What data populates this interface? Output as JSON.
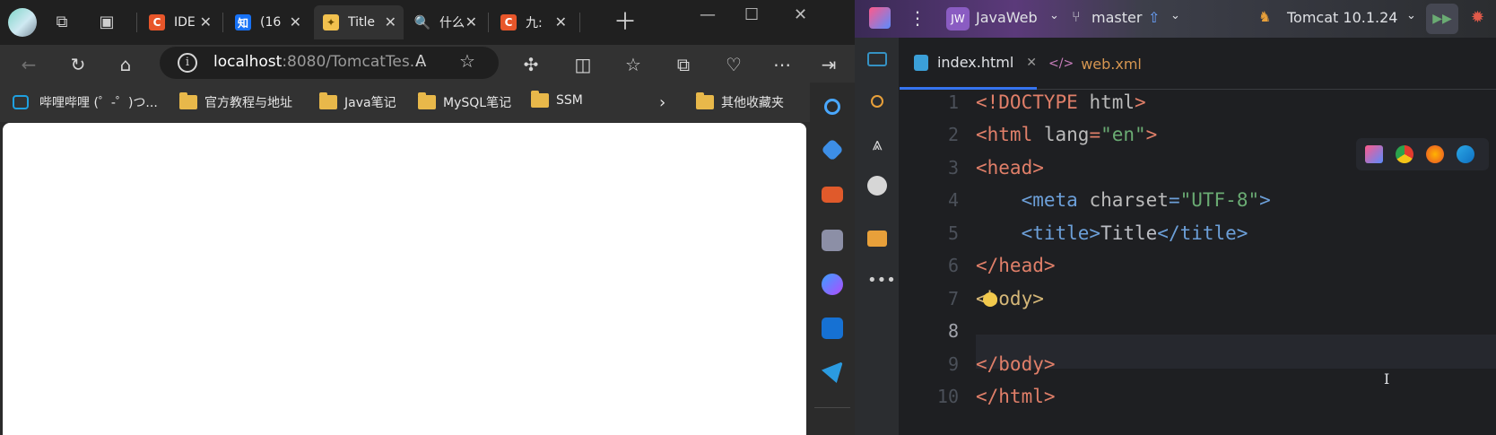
{
  "browser": {
    "tabs": [
      {
        "label": "IDE",
        "favicon": "C",
        "color": "#e8562a"
      },
      {
        "label": "(16",
        "favicon": "知",
        "color": "#1772f6"
      },
      {
        "label": "Title",
        "favicon": "tomcat",
        "color": "#f2c14e"
      },
      {
        "label": "什么",
        "favicon": "search",
        "color": "#1f6feb"
      },
      {
        "label": "九:",
        "favicon": "C",
        "color": "#e8562a"
      }
    ],
    "address": {
      "host": "localhost",
      "rest": ":8080/TomcatTes..."
    },
    "bookmarks": [
      "哔哩哔哩 (゜-゜)つ...",
      "官方教程与地址",
      "Java笔记",
      "MySQL笔记",
      "SSM",
      "其他收藏夹"
    ]
  },
  "ide": {
    "project_badge": "JW",
    "project": "JavaWeb",
    "branch": "master",
    "run_config": "Tomcat 10.1.24",
    "tabs": [
      {
        "label": "index.html",
        "icon": "html-icon"
      },
      {
        "label": "web.xml",
        "icon": "xml-icon"
      }
    ],
    "line_numbers": [
      "1",
      "2",
      "3",
      "4",
      "5",
      "6",
      "7",
      "8",
      "9",
      "10"
    ]
  }
}
